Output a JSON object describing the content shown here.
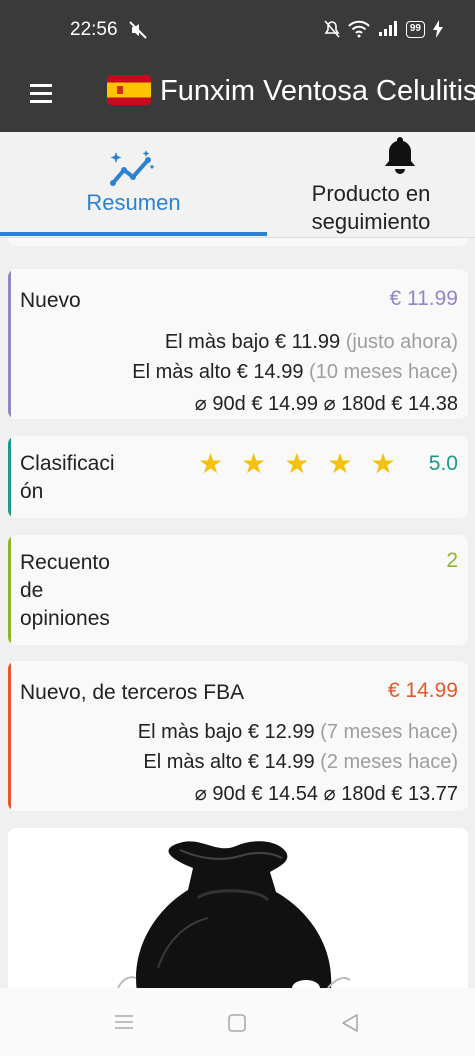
{
  "status": {
    "time": "22:56",
    "battery": "99"
  },
  "app": {
    "title": "Funxim Ventosa Celulitis"
  },
  "tabs": [
    {
      "label": "Resumen",
      "active": true
    },
    {
      "label": "Producto en seguimiento",
      "active": false
    }
  ],
  "cards": {
    "nuevo": {
      "title": "Nuevo",
      "price": "€ 11.99",
      "accent": "#8e88c9",
      "lowest_label": "El màs bajo",
      "lowest_value": "€ 11.99",
      "lowest_when": "(justo ahora)",
      "highest_label": "El màs alto",
      "highest_value": "€ 14.99",
      "highest_when": "(10 meses hace)",
      "avg90_label": "⌀ 90d",
      "avg90_value": "€ 14.99",
      "avg180_label": "⌀ 180d",
      "avg180_value": "€ 14.38"
    },
    "rating": {
      "title": "Clasificaci ón",
      "value": "5.0",
      "stars": 5,
      "accent": "#1a9a8a"
    },
    "reviews": {
      "title": "Recuento de opiniones",
      "value": "2",
      "accent": "#8db52a"
    },
    "fba": {
      "title": "Nuevo, de terceros FBA",
      "price": "€ 14.99",
      "accent": "#e8562a",
      "lowest_label": "El màs bajo",
      "lowest_value": "€ 12.99",
      "lowest_when": "(7 meses hace)",
      "highest_label": "El màs alto",
      "highest_value": "€ 14.99",
      "highest_when": "(2 meses hace)",
      "avg90_label": "⌀ 90d",
      "avg90_value": "€ 14.54",
      "avg180_label": "⌀ 180d",
      "avg180_value": "€ 13.77"
    }
  },
  "icons": {
    "menu": "hamburger-menu-icon",
    "flag": "spain-flag-icon",
    "summary": "trend-sparkle-icon",
    "tracking": "bell-icon",
    "product": "black-satin-pouch-image"
  }
}
